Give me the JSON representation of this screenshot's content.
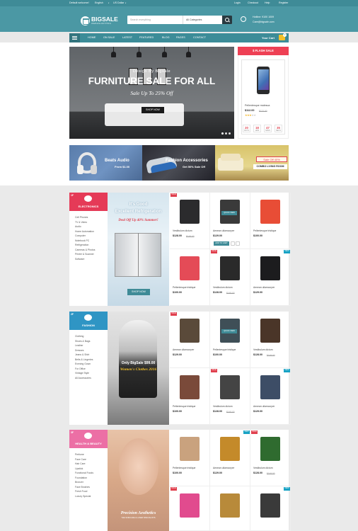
{
  "topbar": {
    "welcome": "Default welcome!",
    "language": "English",
    "currency": "US Dollar",
    "login": "Login",
    "checkout": "Checkout",
    "help": "Help",
    "register": "Register"
  },
  "header": {
    "logo_title": "BIGSALE",
    "logo_subtitle": "WEB&SHOPPING",
    "search_placeholder": "Search everything",
    "search_category": "All Categories",
    "hotline": "Hotline: 9100 1009",
    "email": "Care@bigsale.com"
  },
  "nav": {
    "items": [
      "HOME",
      "ON SALE",
      "LATEST",
      "FEATURED",
      "BLOG",
      "PAGES",
      "CONTACT"
    ],
    "cart_label": "Your Cart",
    "cart_count": "0"
  },
  "hero": {
    "subtitle": "Design By Bigsale",
    "title": "FURNITURE SALE FOR ALL",
    "sale_text": "Sale Up To 25% Off",
    "button": "SHOP NOW"
  },
  "flash": {
    "title": "$ FLASH SALE",
    "product_name": "Pellentesque malesua",
    "price": "$112.00",
    "old_price": "$122.00",
    "countdown": [
      {
        "value": "20",
        "label": "DAYS"
      },
      {
        "value": "18",
        "label": "HRS"
      },
      {
        "value": "47",
        "label": "MINS"
      },
      {
        "value": "35",
        "label": "SECS"
      }
    ]
  },
  "banners": {
    "beats_title": "Beats Audio",
    "beats_sub": "From $1.00",
    "fashion_title": "Fashion Accessories",
    "fashion_sub": "Get 50% Sale Off",
    "sofa_badge": "Sale Off 40%",
    "sofa_title": "COMBO LIVING ROOM"
  },
  "categories": [
    {
      "num": "1F",
      "title": "ELECTRONICS",
      "color": "#e53a57",
      "links": [
        "Cell Phones",
        "TV & Video",
        "Audio",
        "Home Automation",
        "Computer",
        "Notebook PC",
        "Refrigeration",
        "Cameras & Photos",
        "Printer & Scanner",
        "Software"
      ],
      "promo_title": "It's Good\nExcellent Refrigeration",
      "promo_sub": "Deal Off Up 40% Summer!",
      "promo_button": "SHOP NOW",
      "products": [
        {
          "name": "Vestibulum dictum",
          "price": "$128.00",
          "old": "$149.00",
          "badge": "SALE",
          "img": "pc"
        },
        {
          "name": "Aenean ullamcorper",
          "price": "$129.00",
          "old": "",
          "badge": "",
          "img": "speaker"
        },
        {
          "name": "Pellentesque tristique",
          "price": "$100.00",
          "old": "",
          "badge": "",
          "img": "tv"
        },
        {
          "name": "Pellentesque tristique",
          "price": "$100.00",
          "old": "",
          "badge": "",
          "img": "phone2"
        },
        {
          "name": "Vestibulum dictum",
          "price": "$128.00",
          "old": "$149.00",
          "badge": "SALE",
          "img": "speakers"
        },
        {
          "name": "Aenean ullamcorper",
          "price": "$129.00",
          "old": "",
          "badge": "NEW",
          "img": "iphone"
        }
      ]
    },
    {
      "num": "2F",
      "title": "FASHION",
      "color": "#2f95c4",
      "links": [
        "Clothing",
        "Shoes & Bags",
        "Leather",
        "Dresses",
        "Jeans & Shirt",
        "Belts & Lingeries",
        "Evening Gown",
        "For Office",
        "Vintage Style",
        "All Accessories"
      ],
      "promo_title": "Only BigSale $99.00",
      "promo_sub": "Women's Clothes 2016",
      "products": [
        {
          "name": "Aenean ullamcorper",
          "price": "$129.00",
          "old": "",
          "badge": "SALE",
          "img": "vest"
        },
        {
          "name": "Pellentesque tristique",
          "price": "$100.00",
          "old": "",
          "badge": "",
          "img": "hoodie"
        },
        {
          "name": "Vestibulum dictum",
          "price": "$128.00",
          "old": "$149.00",
          "badge": "",
          "img": "jacket"
        },
        {
          "name": "Pellentesque tristique",
          "price": "$100.00",
          "old": "",
          "badge": "",
          "img": "vest2"
        },
        {
          "name": "Vestibulum dictum",
          "price": "$128.00",
          "old": "$149.00",
          "badge": "SALE",
          "img": "coat"
        },
        {
          "name": "Aenean ullamcorper",
          "price": "$129.00",
          "old": "",
          "badge": "NEW",
          "img": "sweater"
        }
      ]
    },
    {
      "num": "3F",
      "title": "HEALTH & BEAUTY",
      "color": "#ec6fa5",
      "links": [
        "Perfume",
        "Face Care",
        "Hair Care",
        "Lipstick",
        "Functional Foods",
        "Foundation",
        "Bronzer",
        "Face Brushes",
        "Fresh Food",
        "Luxury Special"
      ],
      "promo_title": "Precision Aesthetics",
      "promo_sub": "THE SKINCARE & LASER SPECIALISTS",
      "products": [
        {
          "name": "Pellentesque tristique",
          "price": "$100.00",
          "old": "",
          "badge": "",
          "img": "powder"
        },
        {
          "name": "Aenean ullamcorper",
          "price": "$129.00",
          "old": "",
          "badge": "NEW",
          "img": "serum"
        },
        {
          "name": "Vestibulum dictum",
          "price": "$128.00",
          "old": "$149.00",
          "badge": "SALE",
          "img": "bottle"
        },
        {
          "name": "",
          "price": "",
          "old": "",
          "badge": "SALE",
          "img": "mascara"
        },
        {
          "name": "",
          "price": "",
          "old": "",
          "badge": "",
          "img": "mascara2"
        },
        {
          "name": "",
          "price": "",
          "old": "",
          "badge": "NEW",
          "img": "jar"
        }
      ]
    }
  ],
  "product_actions": {
    "add_to_cart": "ADD TO CART",
    "quick_view": "QUICK VIEW"
  }
}
